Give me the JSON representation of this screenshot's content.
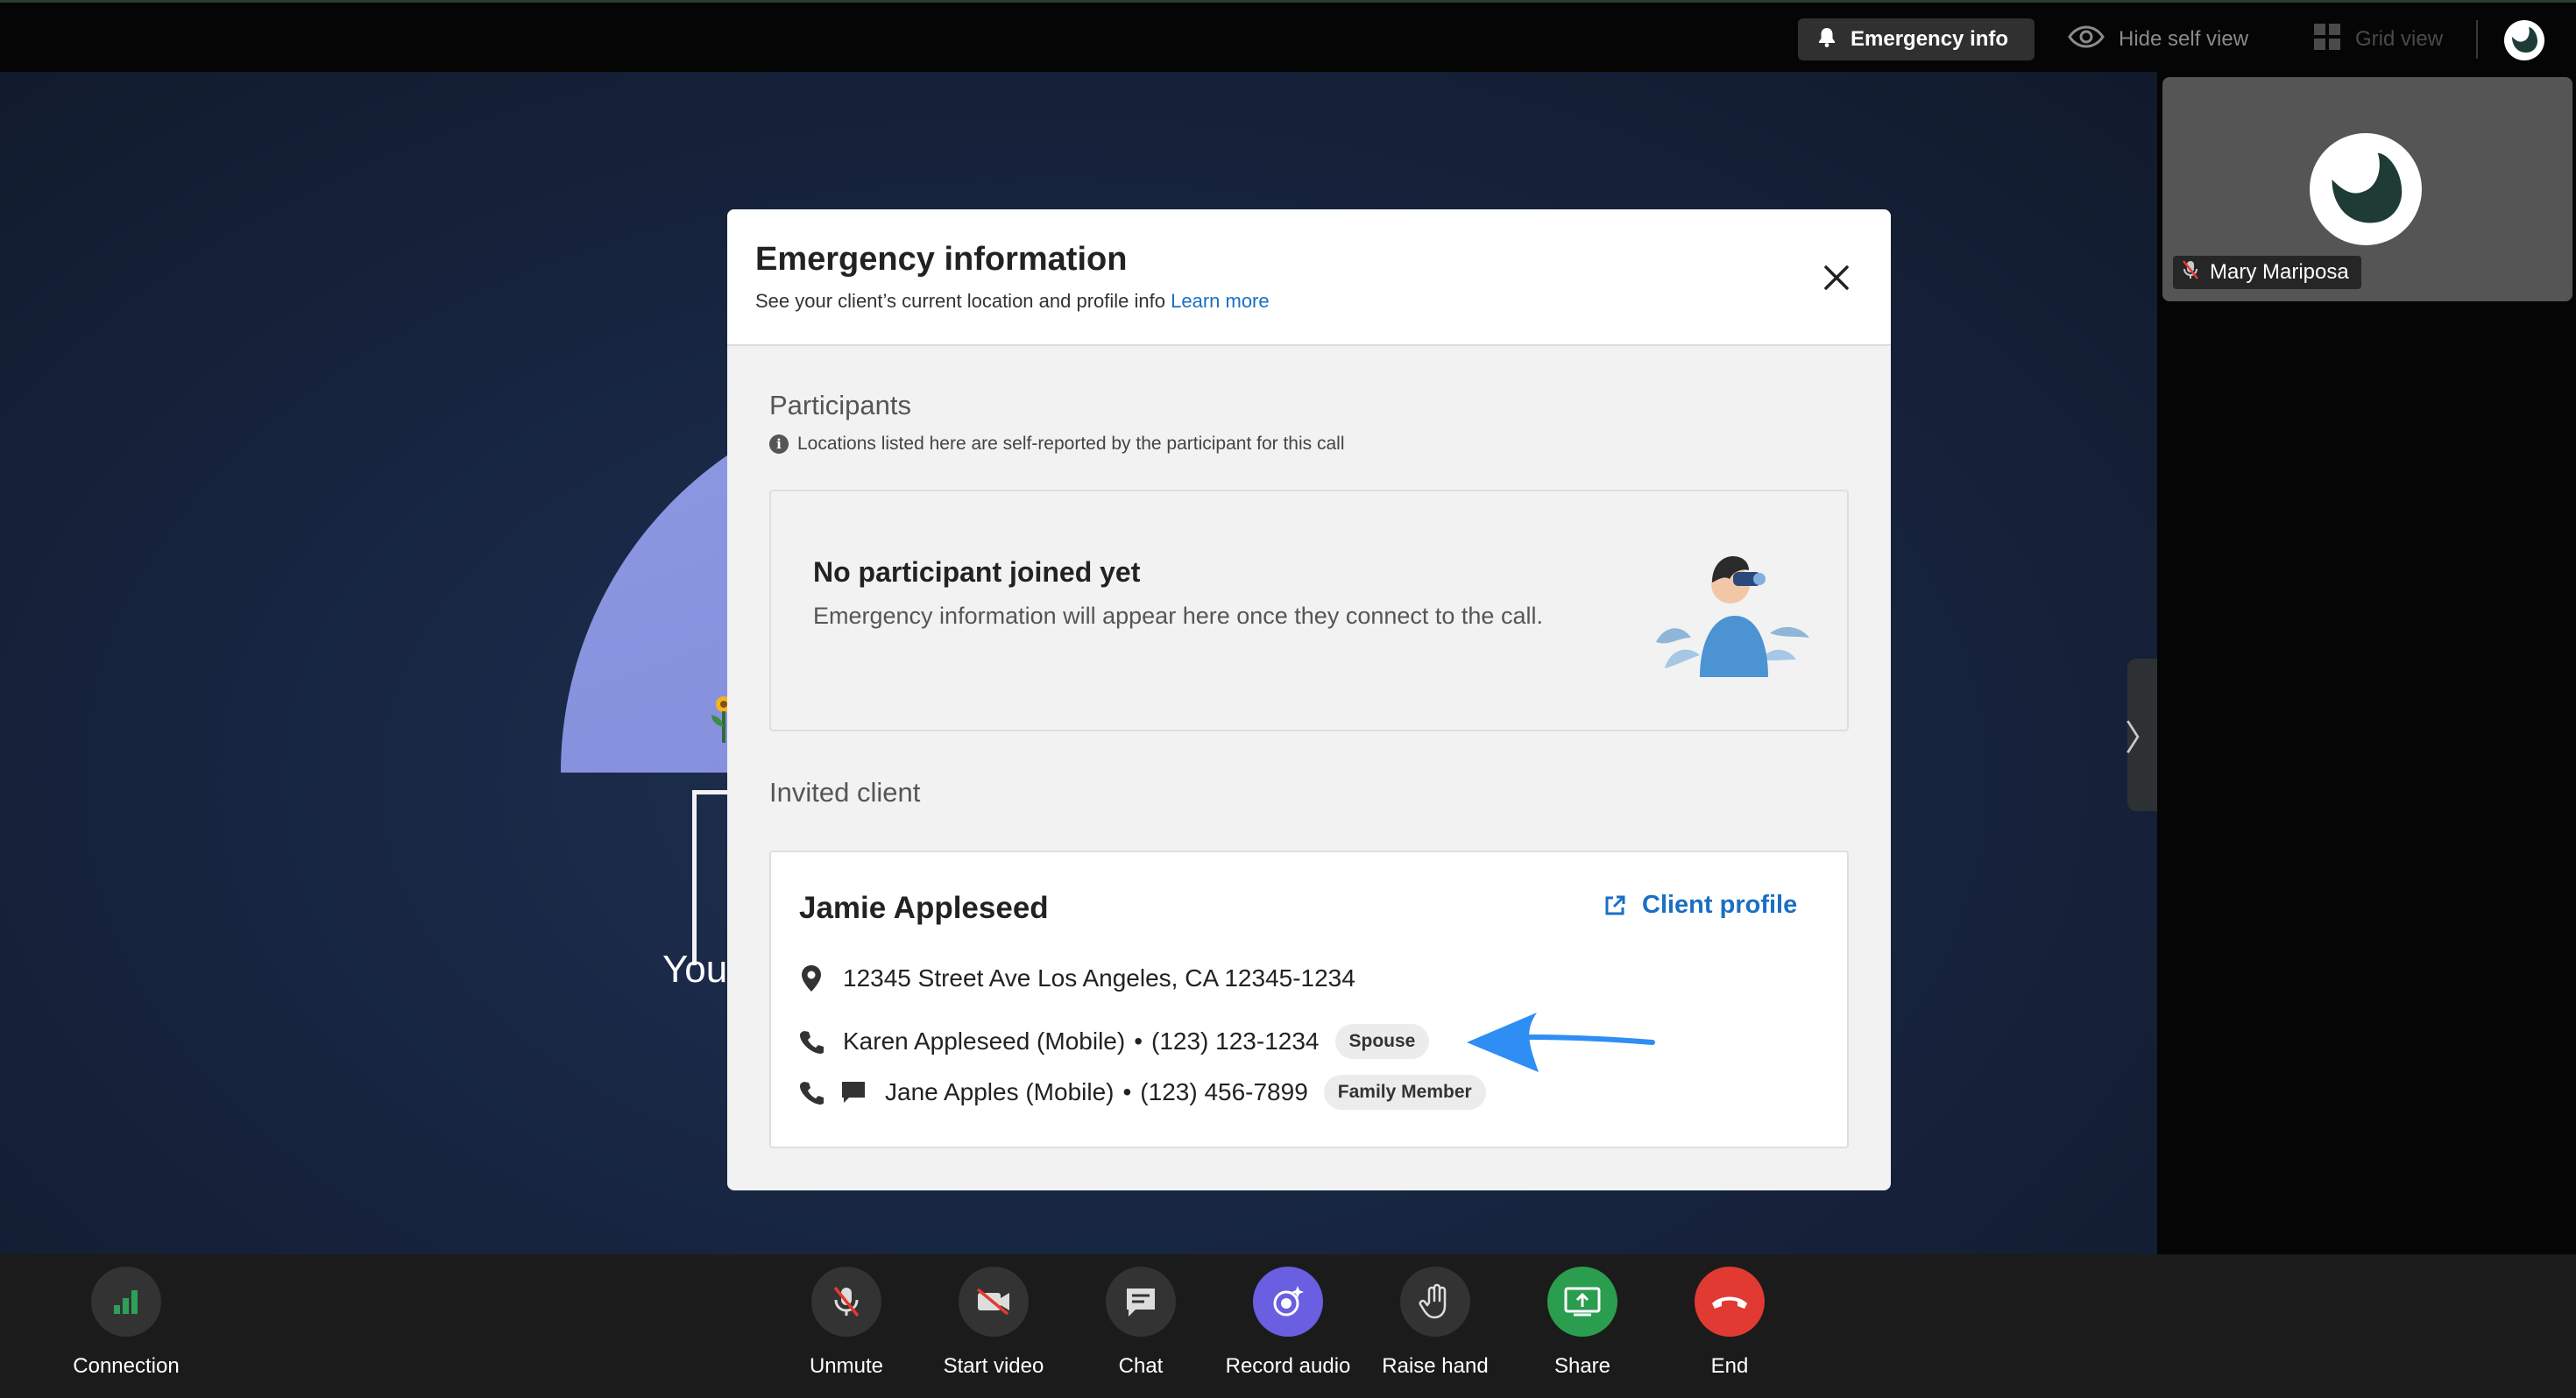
{
  "topbar": {
    "emergency_label": "Emergency info",
    "hide_self_label": "Hide self view",
    "grid_label": "Grid view"
  },
  "self_view": {
    "name": "Mary Mariposa"
  },
  "stage": {
    "partial_text": "You"
  },
  "modal": {
    "title": "Emergency information",
    "subtitle": "See your client’s current location and profile info",
    "learn_more": "Learn more",
    "participants": {
      "title": "Participants",
      "note": "Locations listed here are self-reported by the participant for this call",
      "empty_title": "No participant joined yet",
      "empty_body": "Emergency information will appear here once they connect to the call."
    },
    "invited": {
      "title": "Invited client",
      "client_name": "Jamie Appleseed",
      "profile_link": "Client profile",
      "address": "12345 Street Ave Los Angeles, CA 12345-1234",
      "contacts": [
        {
          "name": "Karen Appleseed (Mobile)",
          "phone": "(123) 123-1234",
          "relation": "Spouse"
        },
        {
          "name": "Jane Apples (Mobile)",
          "phone": "(123) 456-7899",
          "relation": "Family Member"
        }
      ]
    }
  },
  "controls": [
    {
      "label": "Connection",
      "icon": "signal-bars-icon"
    },
    {
      "label": "Unmute",
      "icon": "mic-off-icon"
    },
    {
      "label": "Start video",
      "icon": "video-off-icon"
    },
    {
      "label": "Chat",
      "icon": "chat-icon"
    },
    {
      "label": "Record audio",
      "icon": "record-audio-icon"
    },
    {
      "label": "Raise hand",
      "icon": "hand-icon"
    },
    {
      "label": "Share",
      "icon": "share-screen-icon"
    },
    {
      "label": "End",
      "icon": "end-call-icon"
    }
  ],
  "colors": {
    "link": "#1a6fc4",
    "record_accent": "#6a5fe0",
    "share_accent": "#2a9d4f",
    "end_accent": "#e13a32",
    "annotation_arrow": "#2f8ef4"
  }
}
